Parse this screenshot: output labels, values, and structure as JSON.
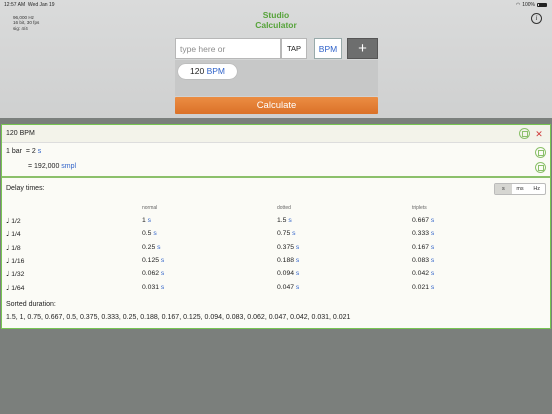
{
  "status": {
    "time": "12:57 AM",
    "date": "Wed Jan 19",
    "battery": "100%"
  },
  "audio": {
    "line1": "96,000 Hz",
    "line2": "16 bit, 30 fps",
    "line3": "sig: 4/4"
  },
  "app": {
    "title_line1": "Studio",
    "title_line2": "Calculator"
  },
  "toolbar": {
    "input_placeholder": "type here or",
    "tap_label": "TAP",
    "unit_label": "BPM",
    "add_label": "+"
  },
  "entry": {
    "value": "120",
    "unit": "BPM"
  },
  "calculate_label": "Calculate",
  "result": {
    "header": "120 BPM",
    "bar_label": "1 bar",
    "bar_eq": "= 2",
    "bar_unit": "s",
    "smpl_eq": "= 192,000",
    "smpl_unit": "smpl",
    "delay_title": "Delay times:",
    "units": [
      "s",
      "ms",
      "Hz"
    ],
    "selected_unit": "s",
    "columns": [
      "normal",
      "dotted",
      "triplets"
    ],
    "rows": [
      {
        "note": "1/2",
        "normal": "1",
        "dotted": "1.5",
        "triplets": "0.667"
      },
      {
        "note": "1/4",
        "normal": "0.5",
        "dotted": "0.75",
        "triplets": "0.333"
      },
      {
        "note": "1/8",
        "normal": "0.25",
        "dotted": "0.375",
        "triplets": "0.167"
      },
      {
        "note": "1/16",
        "normal": "0.125",
        "dotted": "0.188",
        "triplets": "0.083"
      },
      {
        "note": "1/32",
        "normal": "0.062",
        "dotted": "0.094",
        "triplets": "0.042"
      },
      {
        "note": "1/64",
        "normal": "0.031",
        "dotted": "0.047",
        "triplets": "0.021"
      }
    ],
    "row_unit": "s",
    "sorted_title": "Sorted duration:",
    "sorted_values": "1.5, 1, 0.75, 0.667, 0.5, 0.375, 0.333, 0.25, 0.188, 0.167, 0.125, 0.094, 0.083, 0.062, 0.047, 0.042, 0.031, 0.021"
  },
  "colors": {
    "accent_green": "#56a33a",
    "calc_orange": "#e07a30",
    "link_blue": "#2f62c9",
    "border_green": "#77c552",
    "close_red": "#d03a3a"
  }
}
